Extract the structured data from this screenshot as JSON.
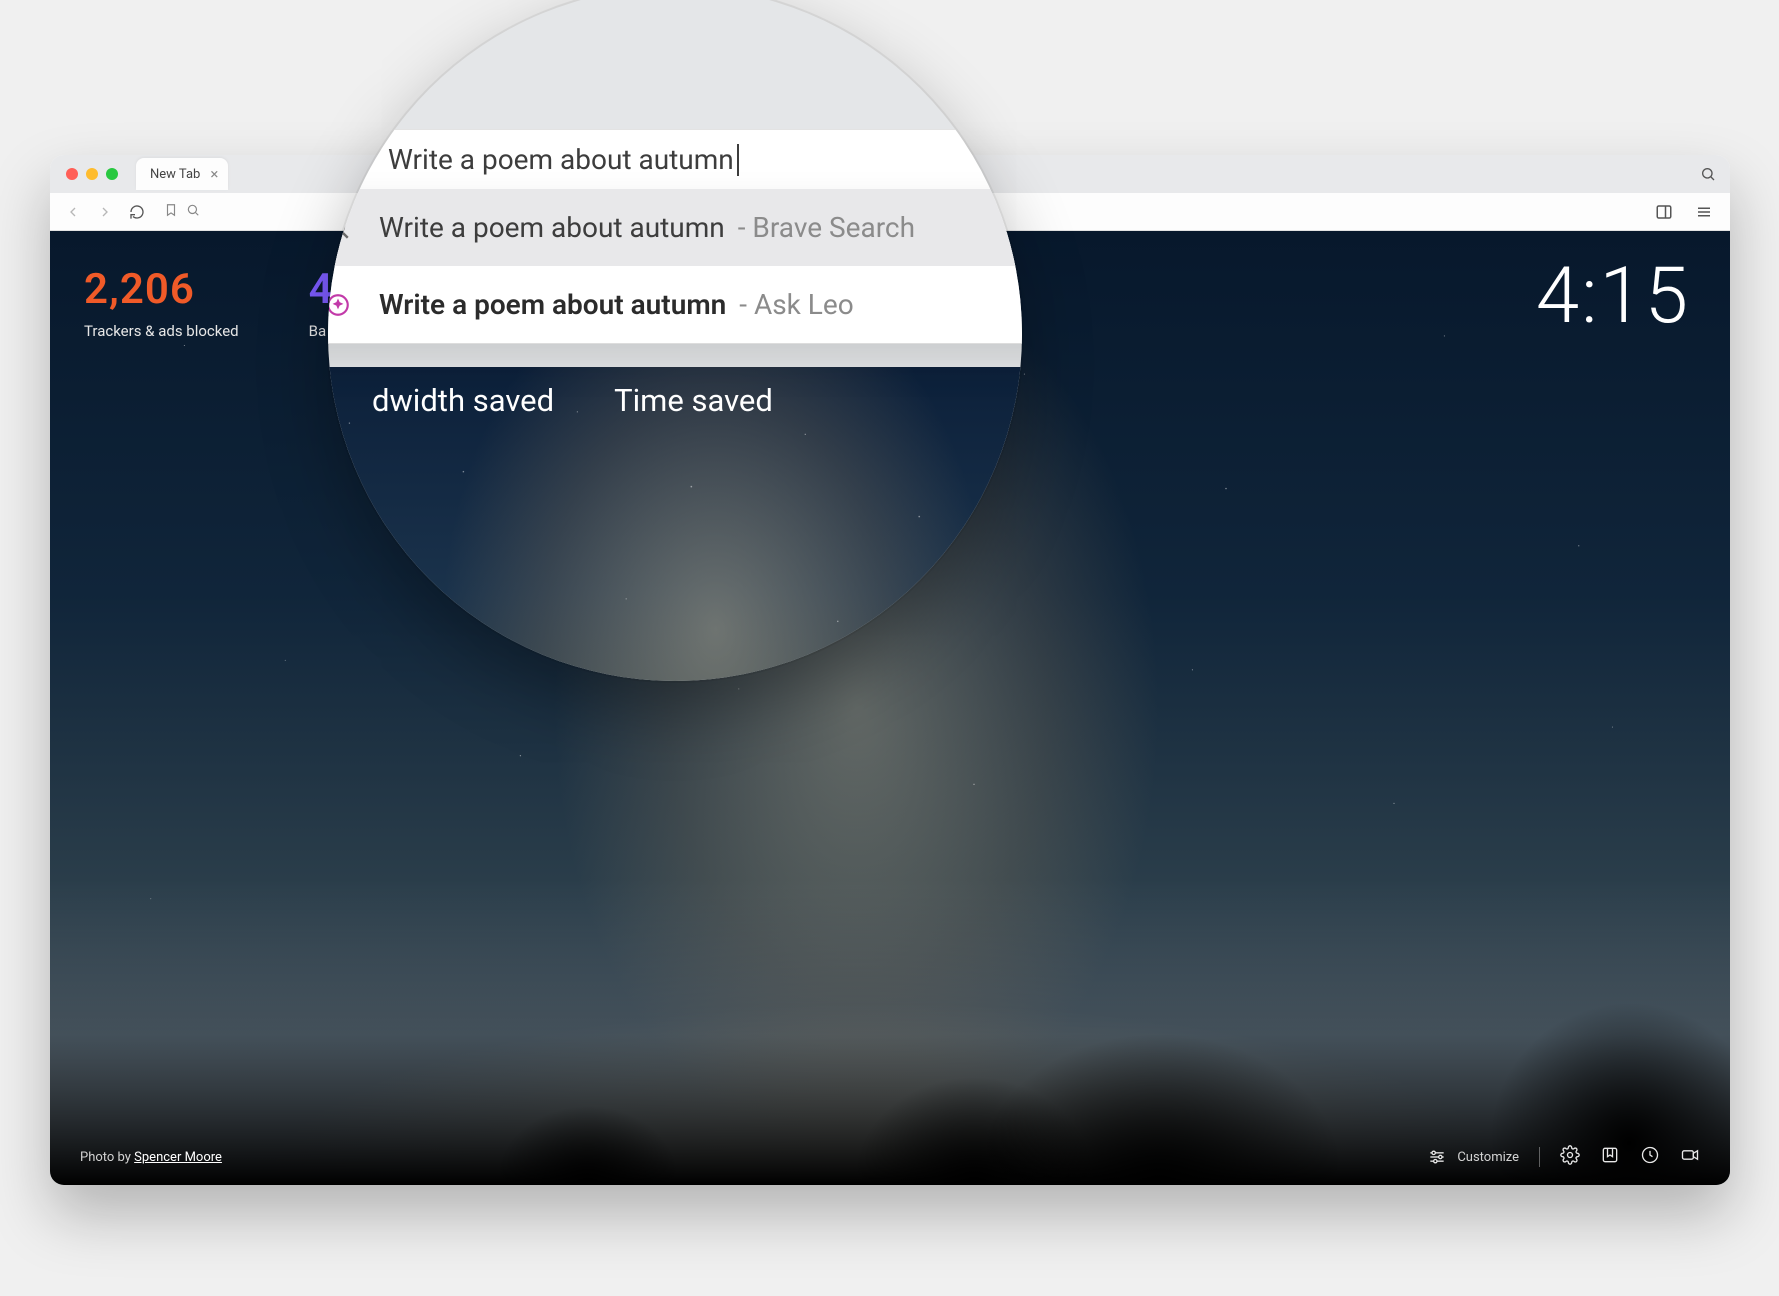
{
  "tab": {
    "title": "New Tab"
  },
  "omnibox": {
    "query": "Write a poem about autumn"
  },
  "suggestions": [
    {
      "query": "Write a poem about autumn",
      "dash": " - ",
      "source": "Brave Search"
    },
    {
      "query": "Write a poem about autumn",
      "dash": "  - ",
      "source": "Ask Leo"
    }
  ],
  "stats": {
    "trackers": {
      "value": "2,206",
      "label": "Trackers & ads blocked"
    },
    "bandwidth": {
      "value": "4",
      "label_prefix": "Ba",
      "label_full": "Bandwidth saved"
    },
    "time": {
      "label_full": "Time saved"
    }
  },
  "mag_stat_labels": {
    "bandwidth": "dwidth saved",
    "time": "Time saved"
  },
  "clock": "4:15",
  "footer": {
    "photo_prefix": "Photo by ",
    "photographer": "Spencer Moore",
    "customize": "Customize"
  }
}
